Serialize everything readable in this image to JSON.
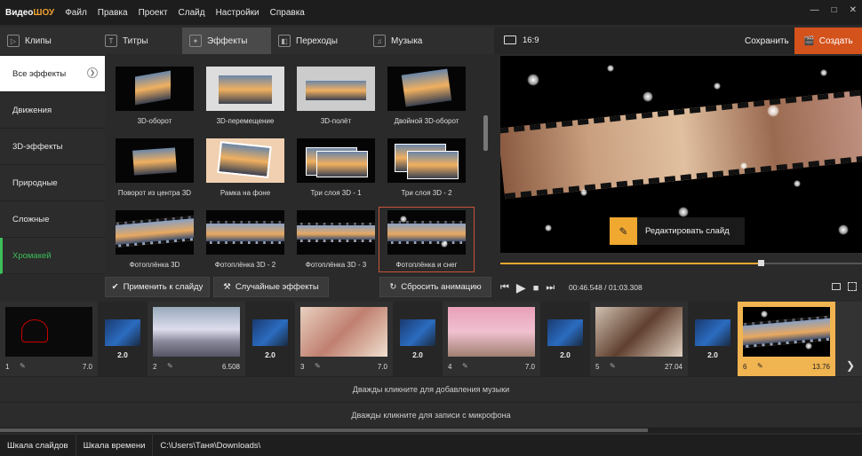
{
  "app": {
    "logo_a": "Видео",
    "logo_b": "ШОУ"
  },
  "menu": [
    "Файл",
    "Правка",
    "Проект",
    "Слайд",
    "Настройки",
    "Справка"
  ],
  "tabs": [
    {
      "label": "Клипы",
      "icon": "clip-icon"
    },
    {
      "label": "Титры",
      "icon": "text-icon"
    },
    {
      "label": "Эффекты",
      "icon": "wand-icon"
    },
    {
      "label": "Переходы",
      "icon": "transition-icon"
    },
    {
      "label": "Музыка",
      "icon": "music-icon"
    }
  ],
  "preview_bar": {
    "ratio": "16:9",
    "save": "Сохранить",
    "create": "Создать"
  },
  "categories": [
    "Все эффекты",
    "Движения",
    "3D-эффекты",
    "Природные",
    "Сложные",
    "Хромакей"
  ],
  "effects": [
    "3D-оборот",
    "3D-перемещение",
    "3D-полёт",
    "Двойной 3D-оборот",
    "Поворот из центра 3D",
    "Рамка на фоне",
    "Три слоя 3D - 1",
    "Три слоя 3D - 2",
    "Фотоплёнка 3D",
    "Фотоплёнка 3D - 2",
    "Фотоплёнка 3D - 3",
    "Фотоплёнка и снег"
  ],
  "buttons": {
    "apply": "Применить к слайду",
    "random": "Случайные эффекты",
    "reset": "Сбросить анимацию"
  },
  "preview": {
    "edit_slide": "Редактировать слайд",
    "time": "00:46.548 / 01:03.308"
  },
  "slides": [
    {
      "num": "1",
      "dur": "7.0"
    },
    {
      "num": "2",
      "dur": "6.508"
    },
    {
      "num": "3",
      "dur": "7.0"
    },
    {
      "num": "4",
      "dur": "7.0"
    },
    {
      "num": "5",
      "dur": "27.04"
    },
    {
      "num": "6",
      "dur": "13.76"
    }
  ],
  "transitions": [
    "2.0",
    "2.0",
    "2.0",
    "2.0",
    "2.0"
  ],
  "tracks": {
    "music": "Дважды кликните для добавления музыки",
    "mic": "Дважды кликните для записи с микрофона"
  },
  "status": {
    "slides_scale": "Шкала слайдов",
    "time_scale": "Шкала времени",
    "path": "C:\\Users\\Таня\\Downloads\\"
  },
  "colors": {
    "accent": "#f0a830",
    "create": "#d4521c",
    "chroma": "#3cbf5a"
  }
}
